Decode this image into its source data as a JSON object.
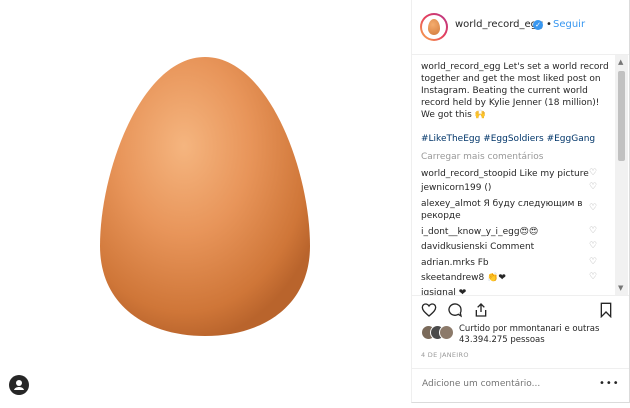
{
  "post": {
    "username": "world_record_egg",
    "follow_label": "Seguir",
    "separator": "•",
    "caption_user": "world_record_egg",
    "caption_text": " Let's set a world record together and get the most liked post on Instagram. Beating the current world record held by Kylie Jenner (18 million)! We got this 🙌",
    "hashtags": "#LikeTheEgg #EggSoldiers #EggGang",
    "load_more": "Carregar mais comentários",
    "comments": [
      {
        "user": "world_record_stoopid",
        "text": " Like my picture"
      },
      {
        "user": "jewnicorn199",
        "text": " ()"
      },
      {
        "user": "alexey_almot",
        "text": " Я буду следующим в рекорде"
      },
      {
        "user": "i_dont__know_y_i_egg",
        "text": "😍😍"
      },
      {
        "user": "davidkusienski",
        "text": " Comment"
      },
      {
        "user": "adrian.mrks",
        "text": " Fb"
      },
      {
        "user": "skeetandrew8",
        "text": " 👏❤"
      },
      {
        "user": "jgsignal",
        "text": " ❤"
      }
    ],
    "likes_text": "Curtido por mmontanari e outras 43.394.275 pessoas",
    "date": "4 DE JANEIRO",
    "add_comment_placeholder": "Adicione um comentário...",
    "more_label": "•••"
  },
  "colors": {
    "link": "#3897f0",
    "hashtag": "#003569",
    "egg": "#e8955a"
  },
  "icons": [
    "heart-icon",
    "comment-icon",
    "share-icon",
    "bookmark-icon",
    "verified-icon",
    "user-icon"
  ]
}
